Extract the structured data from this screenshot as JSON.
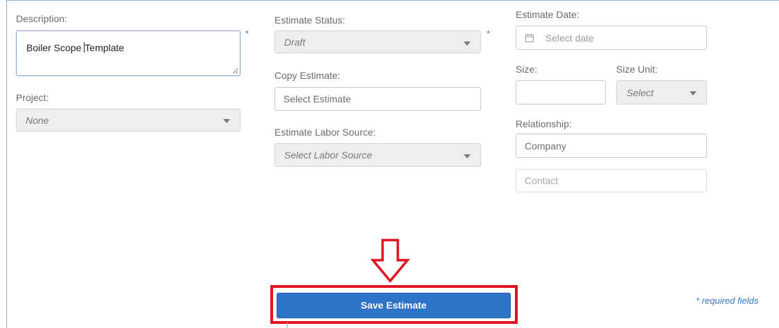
{
  "form": {
    "description": {
      "label": "Description:",
      "value_before": "Boiler Scope ",
      "value_after": "Template",
      "required_mark": "*"
    },
    "project": {
      "label": "Project:",
      "value": "None"
    },
    "estimate_status": {
      "label": "Estimate Status:",
      "value": "Draft",
      "required_mark": "*"
    },
    "copy_estimate": {
      "label": "Copy Estimate:",
      "placeholder": "Select Estimate"
    },
    "labor_source": {
      "label": "Estimate Labor Source:",
      "placeholder": "Select Labor Source"
    },
    "estimate_date": {
      "label": "Estimate Date:",
      "placeholder": "Select date"
    },
    "size": {
      "label": "Size:",
      "value": ""
    },
    "size_unit": {
      "label": "Size Unit:",
      "placeholder": "Select"
    },
    "relationship": {
      "label": "Relationship:",
      "company_placeholder": "Company",
      "contact_placeholder": "Contact"
    }
  },
  "actions": {
    "save_label": "Save Estimate"
  },
  "footer": {
    "required_note": "* required fields"
  },
  "annotation": {
    "highlight_color": "#e0141f",
    "arrow": "down-arrow"
  },
  "colors": {
    "primary_button": "#2f73c9",
    "required_mark": "#3b78c4"
  }
}
